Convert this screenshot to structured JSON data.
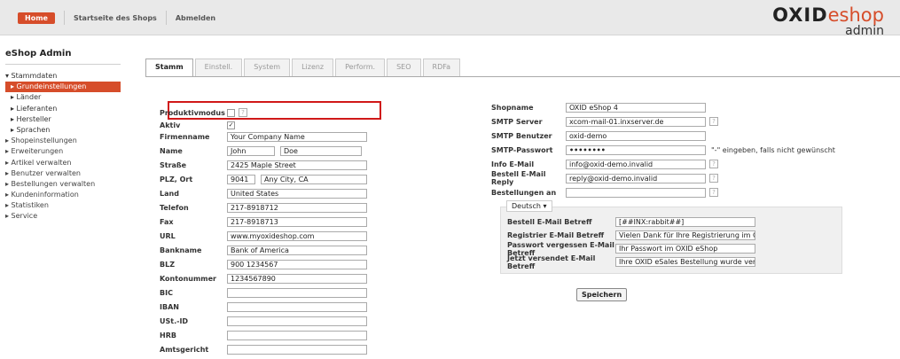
{
  "header": {
    "home": "Home",
    "shop_start": "Startseite des Shops",
    "logout": "Abmelden",
    "brand_oxid": "OXID",
    "brand_eshop": "eshop",
    "brand_admin": "admin"
  },
  "sidebar": {
    "title": "eShop Admin",
    "items": [
      "▾ Stammdaten",
      "▸ Grundeinstellungen",
      "▸ Länder",
      "▸ Lieferanten",
      "▸ Hersteller",
      "▸ Sprachen",
      "▸ Shopeinstellungen",
      "▸ Erweiterungen",
      "▸ Artikel verwalten",
      "▸ Benutzer verwalten",
      "▸ Bestellungen verwalten",
      "▸ Kundeninformation",
      "▸ Statistiken",
      "▸ Service"
    ]
  },
  "tabs": [
    "Stamm",
    "Einstell.",
    "System",
    "Lizenz",
    "Perform.",
    "SEO",
    "RDFa"
  ],
  "left_form": {
    "produktivmodus": "Produktivmodus",
    "aktiv": "Aktiv",
    "firmenname": "Firmenname",
    "firmenname_val": "Your Company Name",
    "name": "Name",
    "first": "John",
    "last": "Doe",
    "strasse": "Straße",
    "strasse_val": "2425 Maple Street",
    "plz_ort": "PLZ, Ort",
    "plz": "9041",
    "ort": "Any City, CA",
    "land": "Land",
    "land_val": "United States",
    "telefon": "Telefon",
    "telefon_val": "217-8918712",
    "fax": "Fax",
    "fax_val": "217-8918713",
    "url": "URL",
    "url_val": "www.myoxideshop.com",
    "bankname": "Bankname",
    "bankname_val": "Bank of America",
    "blz": "BLZ",
    "blz_val": "900 1234567",
    "kontonummer": "Kontonummer",
    "kontonummer_val": "1234567890",
    "bic": "BIC",
    "iban": "IBAN",
    "ust": "USt.-ID",
    "hrb": "HRB",
    "amtsgericht": "Amtsgericht"
  },
  "right_form": {
    "shopname": "Shopname",
    "shopname_val": "OXID eShop 4",
    "smtp_server": "SMTP Server",
    "smtp_server_val": "xcom-mail-01.inxserver.de",
    "smtp_user": "SMTP Benutzer",
    "smtp_user_val": "oxid-demo",
    "smtp_pass": "SMTP-Passwort",
    "smtp_pass_val": "••••••••",
    "smtp_hint": "\"-\" eingeben, falls nicht gewünscht",
    "info_email": "Info E-Mail",
    "info_email_val": "info@oxid-demo.invalid",
    "order_reply": "Bestell E-Mail Reply",
    "order_reply_val": "reply@oxid-demo.invalid",
    "orders_to": "Bestellungen an",
    "language": "Deutsch",
    "order_subject": "Bestell E-Mail Betreff",
    "order_subject_val": "[##INX:rabbit##]",
    "reg_subject": "Registrier E-Mail Betreff",
    "reg_subject_val": "Vielen Dank für Ihre Registrierung im OX",
    "pw_subject": "Passwort vergessen E-Mail Betreff",
    "pw_subject_val": "Ihr Passwort im OXID eShop",
    "now_subject": "Jetzt versendet E-Mail Betreff",
    "now_subject_val": "Ihre OXID eSales Bestellung wurde versa",
    "save": "Speichern"
  }
}
